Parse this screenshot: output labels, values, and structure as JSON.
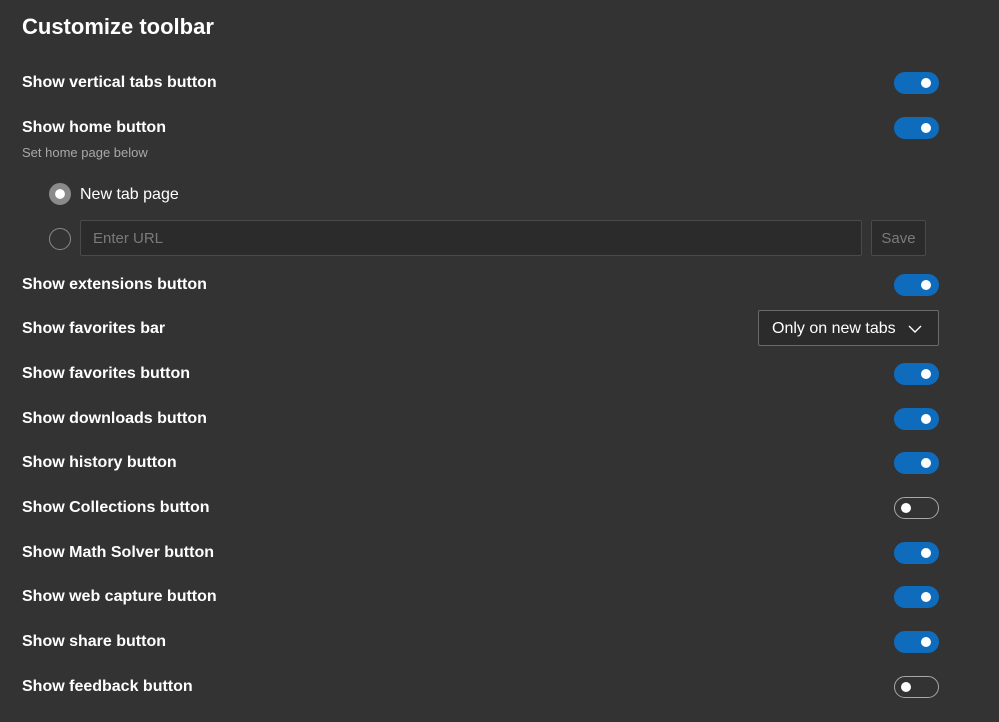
{
  "page": {
    "title": "Customize toolbar"
  },
  "settings": {
    "vertical_tabs": {
      "label": "Show vertical tabs button",
      "on": true
    },
    "home": {
      "label": "Show home button",
      "on": true,
      "sub_text": "Set home page below",
      "option_new_tab": {
        "label": "New tab page",
        "selected": true
      },
      "option_url": {
        "placeholder": "Enter URL",
        "value": "",
        "selected": false
      },
      "save_label": "Save"
    },
    "extensions": {
      "label": "Show extensions button",
      "on": true
    },
    "favorites_bar": {
      "label": "Show favorites bar",
      "selected": "Only on new tabs"
    },
    "favorites": {
      "label": "Show favorites button",
      "on": true
    },
    "downloads": {
      "label": "Show downloads button",
      "on": true
    },
    "history": {
      "label": "Show history button",
      "on": true
    },
    "collections": {
      "label": "Show Collections button",
      "on": false
    },
    "math_solver": {
      "label": "Show Math Solver button",
      "on": true
    },
    "web_capture": {
      "label": "Show web capture button",
      "on": true
    },
    "share": {
      "label": "Show share button",
      "on": true
    },
    "feedback": {
      "label": "Show feedback button",
      "on": false
    }
  },
  "colors": {
    "background": "#333333",
    "toggle_on": "#0f6cbd",
    "toggle_off_border": "#a8a8a8",
    "text": "#ffffff",
    "muted_text": "#a8a8a8"
  },
  "icons": {
    "dropdown": "chevron-down-icon"
  }
}
